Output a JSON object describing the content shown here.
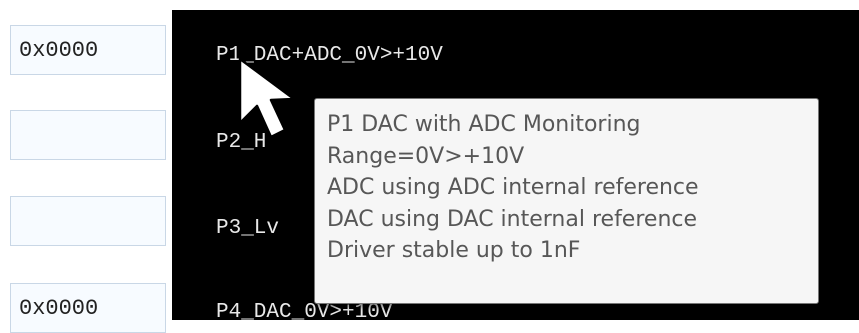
{
  "hex_fields": [
    {
      "value": "0x0000"
    },
    {
      "value": ""
    },
    {
      "value": ""
    },
    {
      "value": "0x0000"
    }
  ],
  "profiles": [
    {
      "label": "P1_DAC+ADC_0V>+10V"
    },
    {
      "label": "P2_H"
    },
    {
      "label": "P3_Lv"
    },
    {
      "label": "P4_DAC_0V>+10V"
    }
  ],
  "tooltip": {
    "lines": [
      "P1 DAC with ADC Monitoring",
      "Range=0V>+10V",
      "ADC using ADC internal reference",
      "DAC using DAC internal reference",
      "Driver stable up to 1nF"
    ]
  },
  "cursor": {
    "icon": "arrow-pointer-icon"
  }
}
